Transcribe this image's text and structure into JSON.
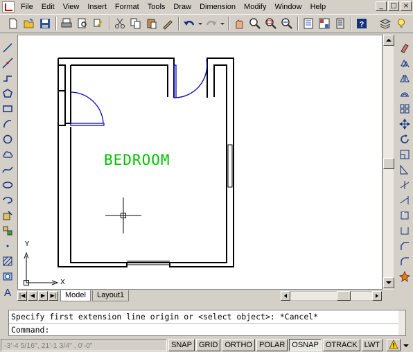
{
  "menubar": {
    "items": [
      "File",
      "Edit",
      "View",
      "Insert",
      "Format",
      "Tools",
      "Draw",
      "Dimension",
      "Modify",
      "Window",
      "Help"
    ],
    "window_buttons": [
      "_",
      "□",
      "×"
    ]
  },
  "toolbar": {
    "buttons": [
      "new-icon",
      "open-icon",
      "save-icon",
      "print-icon",
      "preview-icon",
      "publish-icon",
      "cut-icon",
      "copy-icon",
      "paste-icon",
      "match-properties-icon",
      "undo-icon",
      "redo-icon",
      "pan-icon",
      "zoom-realtime-icon",
      "zoom-window-icon",
      "zoom-previous-icon",
      "properties-icon",
      "design-center-icon",
      "tool-palettes-icon",
      "help-icon"
    ]
  },
  "drawing": {
    "room_label": "BEDROOM",
    "room_label_color": "#00c000",
    "ucs_x_label": "X",
    "ucs_y_label": "Y"
  },
  "tabs": {
    "model": "Model",
    "layout1": "Layout1"
  },
  "command": {
    "history": "Specify first extension line origin or <select object>: *Cancel*",
    "prompt": "Command:"
  },
  "status": {
    "coords": "-3'-4 5/16\",  21'-1 3/4\" , 0'-0\"",
    "buttons": [
      {
        "label": "SNAP",
        "pressed": false
      },
      {
        "label": "GRID",
        "pressed": false
      },
      {
        "label": "ORTHO",
        "pressed": false
      },
      {
        "label": "POLAR",
        "pressed": false
      },
      {
        "label": "OSNAP",
        "pressed": true
      },
      {
        "label": "OTRACK",
        "pressed": false
      },
      {
        "label": "LWT",
        "pressed": false
      }
    ]
  },
  "colors": {
    "door_arc": "#0000c0",
    "ui_gray": "#d4d0c8"
  }
}
